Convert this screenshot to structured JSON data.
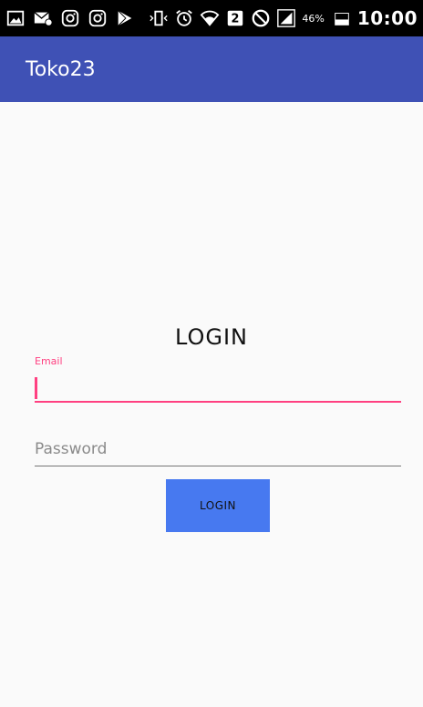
{
  "status_bar": {
    "left_icons": [
      "image-icon",
      "mail-icon",
      "instagram-icon",
      "instagram-icon",
      "play-store-icon"
    ],
    "right_icons": [
      "vibrate-icon",
      "alarm-icon",
      "wifi-icon",
      "sim-2-icon",
      "do-not-disturb-icon",
      "signal-icon"
    ],
    "battery_percent": "46%",
    "battery_level": 0.46,
    "time": "10:00"
  },
  "app_bar": {
    "title": "Toko23",
    "color": "#3f51b5"
  },
  "login_form": {
    "heading": "LOGIN",
    "email_label": "Email",
    "email_value": "",
    "password_placeholder": "Password",
    "password_value": "",
    "login_button_label": "LOGIN",
    "accent_color": "#ff4081",
    "button_color": "#4779f0"
  }
}
